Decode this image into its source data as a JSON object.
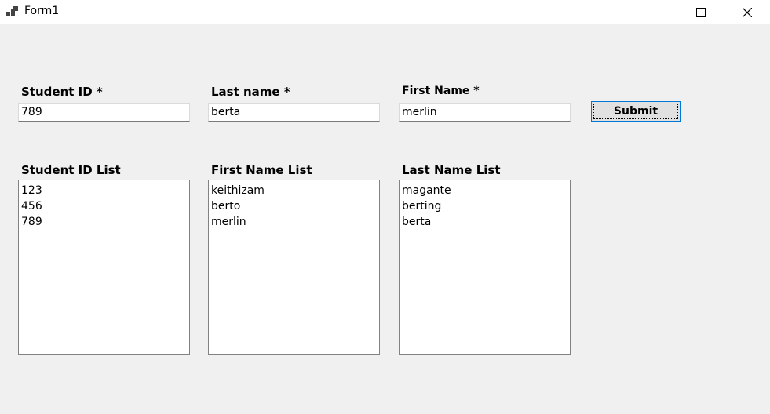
{
  "window": {
    "title": "Form1",
    "icons": {
      "app": "app-form-icon",
      "minimize": "minimize-icon",
      "maximize": "maximize-icon",
      "close": "close-icon"
    }
  },
  "form": {
    "student_id": {
      "label": "Student ID *",
      "value": "789"
    },
    "last_name": {
      "label": "Last name *",
      "value": "berta"
    },
    "first_name": {
      "label": "First Name *",
      "value": "merlin"
    },
    "submit_label": "Submit"
  },
  "lists": {
    "student_ids": {
      "label": "Student ID List",
      "items": [
        "123",
        "456",
        "789"
      ]
    },
    "first_names": {
      "label": "First Name List",
      "items": [
        "keithizam",
        "berto",
        "merlin"
      ]
    },
    "last_names": {
      "label": "Last Name List",
      "items": [
        "magante",
        "berting",
        "berta"
      ]
    }
  }
}
